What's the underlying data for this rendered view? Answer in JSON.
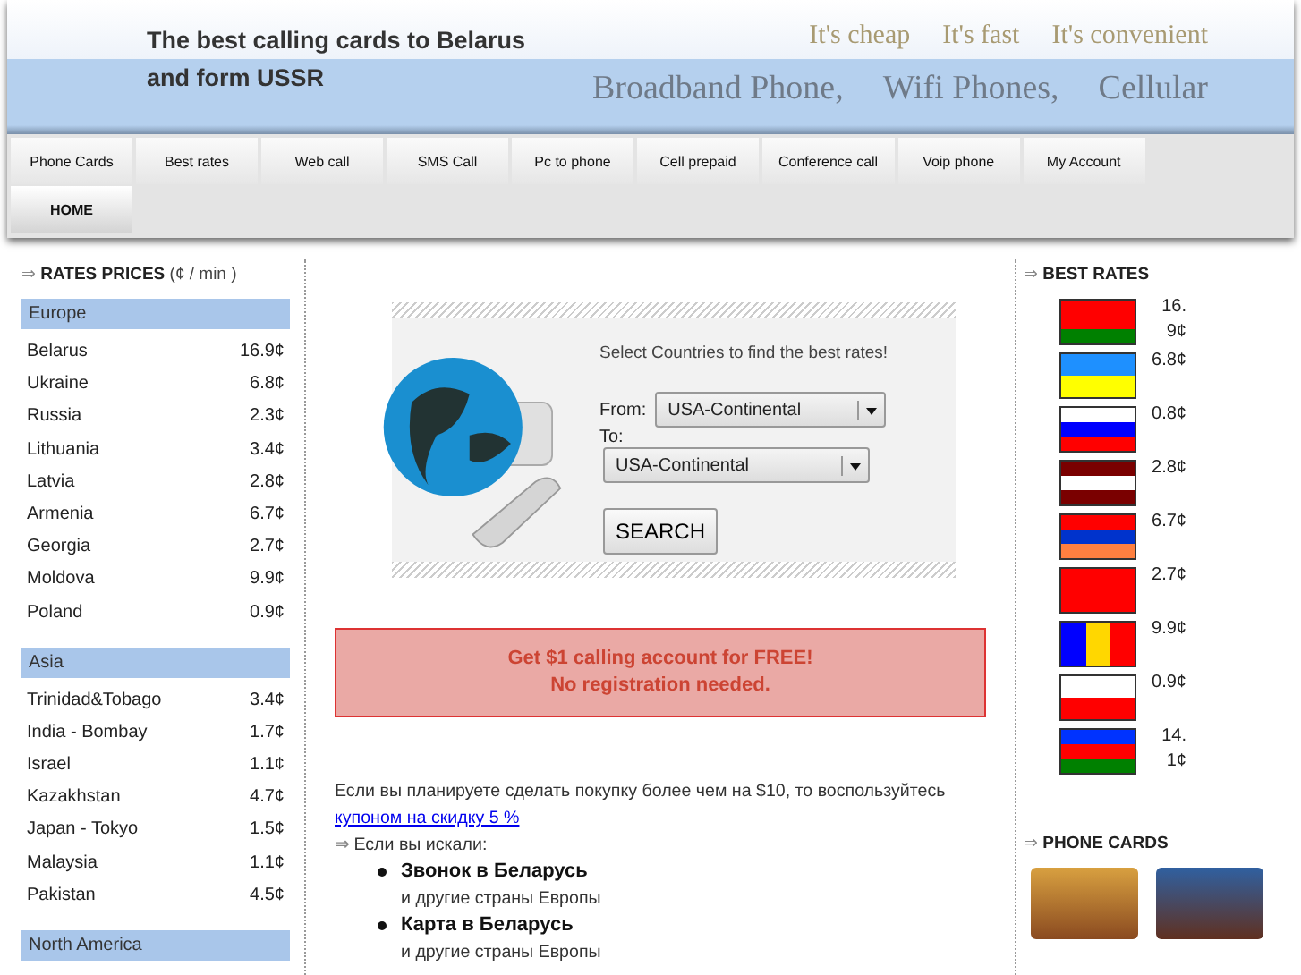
{
  "header": {
    "headline": "The best calling cards to Belarus and form USSR",
    "taglines": [
      "It's cheap",
      "It's fast",
      "It's convenient"
    ],
    "services": [
      "Broadband Phone,",
      "Wifi Phones,",
      "Cellular"
    ]
  },
  "nav": [
    {
      "label": "Phone Cards",
      "selected": false
    },
    {
      "label": "Best rates",
      "selected": false
    },
    {
      "label": "Web call",
      "selected": false
    },
    {
      "label": "SMS Call",
      "selected": false
    },
    {
      "label": "Pc to phone",
      "selected": false
    },
    {
      "label": "Cell prepaid",
      "selected": false
    },
    {
      "label": "Conference call",
      "selected": false
    },
    {
      "label": "Voip phone",
      "selected": false
    },
    {
      "label": "My Account",
      "selected": false
    },
    {
      "label": "HOME",
      "selected": true
    }
  ],
  "rates": {
    "title": "RATES PRICES",
    "unit": "(¢ / min )",
    "arrow": "⇒",
    "groups": [
      {
        "name": "Europe",
        "rows": [
          {
            "country": "Belarus",
            "rate": "16.9¢"
          },
          {
            "country": "Ukraine",
            "rate": "6.8¢"
          },
          {
            "country": "Russia",
            "rate": "2.3¢"
          },
          {
            "country": "Lithuania",
            "rate": "3.4¢"
          },
          {
            "country": "Latvia",
            "rate": "2.8¢"
          },
          {
            "country": "Armenia",
            "rate": "6.7¢"
          },
          {
            "country": "Georgia",
            "rate": "2.7¢"
          },
          {
            "country": "Moldova",
            "rate": "9.9¢"
          },
          {
            "country": "Poland",
            "rate": "0.9¢"
          }
        ]
      },
      {
        "name": "Asia",
        "rows": [
          {
            "country": "Trinidad&Tobago",
            "rate": "3.4¢"
          },
          {
            "country": "India - Bombay",
            "rate": "1.7¢"
          },
          {
            "country": "Israel",
            "rate": "1.1¢"
          },
          {
            "country": "Kazakhstan",
            "rate": "4.7¢"
          },
          {
            "country": "Japan - Tokyo",
            "rate": "1.5¢"
          },
          {
            "country": "Malaysia",
            "rate": "1.1¢"
          },
          {
            "country": "Pakistan",
            "rate": "4.5¢"
          }
        ]
      },
      {
        "name": "North America"
      }
    ]
  },
  "search": {
    "prompt": "Select Countries to find the best rates!",
    "from_label": "From:",
    "from_value": "USA-Continental",
    "to_label": "To:",
    "to_value": "USA-Continental",
    "button": "SEARCH"
  },
  "promo": [
    "Get $1 calling account for FREE!",
    "No registration needed."
  ],
  "info": {
    "text": "Если вы планируете сделать покупку более чем на $10, то воспользуйтесь",
    "link": "купоном на скидку 5 %",
    "arrow": "⇒",
    "lead": "Если вы искали:",
    "items": [
      {
        "title": "Звонок в Беларусь",
        "note": "и другие страны Европы"
      },
      {
        "title": "Карта в Беларусь",
        "note": "и другие страны Европы"
      }
    ]
  },
  "best_rates": {
    "title": "BEST RATES",
    "arrow": "⇒",
    "items": [
      {
        "rate": "16.9¢",
        "kind": "belarus"
      },
      {
        "rate": "6.8¢",
        "kind": "ukraine"
      },
      {
        "rate": "0.8¢",
        "kind": "russia"
      },
      {
        "rate": "2.8¢",
        "kind": "latvia"
      },
      {
        "rate": "6.7¢",
        "kind": "armenia"
      },
      {
        "rate": "2.7¢",
        "kind": "georgia"
      },
      {
        "rate": "9.9¢",
        "kind": "moldova"
      },
      {
        "rate": "0.9¢",
        "kind": "poland"
      },
      {
        "rate": "14.1¢",
        "kind": "azerbaijan"
      }
    ]
  },
  "phone_cards": {
    "title": "PHONE CARDS",
    "arrow": "⇒"
  }
}
